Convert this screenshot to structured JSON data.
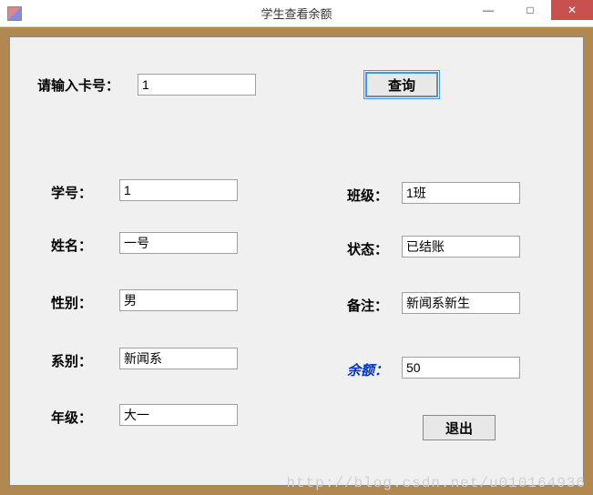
{
  "window": {
    "title": "学生查看余额",
    "minimize": "—",
    "maximize": "□",
    "close": "✕"
  },
  "search": {
    "label": "请输入卡号：",
    "value": "1",
    "query_button": "查询"
  },
  "fields": {
    "student_id": {
      "label": "学号：",
      "value": "1"
    },
    "name": {
      "label": "姓名：",
      "value": "一号"
    },
    "gender": {
      "label": "性别：",
      "value": "男"
    },
    "department": {
      "label": "系别：",
      "value": "新闻系"
    },
    "grade": {
      "label": "年级：",
      "value": "大一"
    },
    "class": {
      "label": "班级：",
      "value": "1班"
    },
    "status": {
      "label": "状态：",
      "value": "已结账"
    },
    "remark": {
      "label": "备注：",
      "value": "新闻系新生"
    },
    "balance": {
      "label": "余额：",
      "value": "50"
    }
  },
  "exit_button": "退出",
  "watermark": "http://blog.csdn.net/u010164936"
}
